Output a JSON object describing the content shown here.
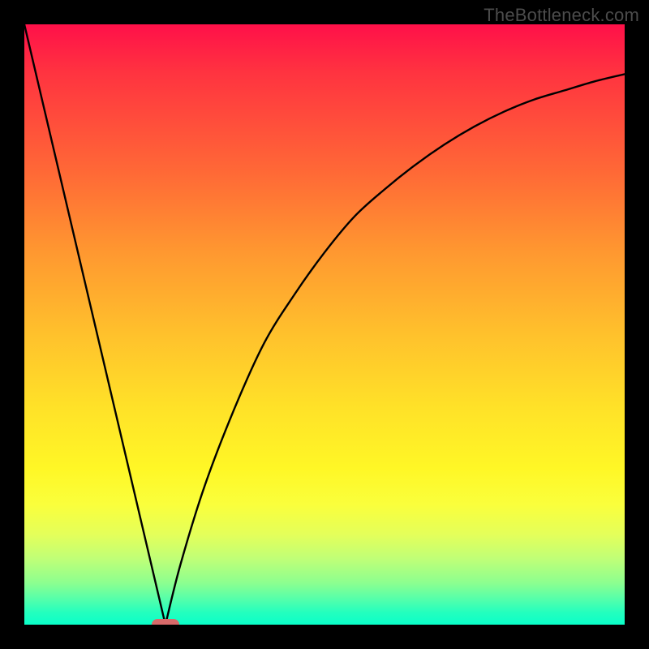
{
  "watermark": "TheBottleneck.com",
  "colors": {
    "frame_bg": "#000000",
    "marker": "#d86a6a",
    "curve": "#000000"
  },
  "chart_data": {
    "type": "line",
    "title": "",
    "xlabel": "",
    "ylabel": "",
    "xlim": [
      0,
      100
    ],
    "ylim": [
      0,
      100
    ],
    "grid": false,
    "legend": false,
    "series": [
      {
        "name": "left-segment",
        "x": [
          0,
          23.5
        ],
        "y": [
          100,
          0
        ]
      },
      {
        "name": "right-segment",
        "x": [
          23.5,
          26,
          30,
          35,
          40,
          45,
          50,
          55,
          60,
          65,
          70,
          75,
          80,
          85,
          90,
          95,
          100
        ],
        "y": [
          0,
          10,
          23,
          36,
          47,
          55,
          62,
          68,
          72.5,
          76.5,
          80,
          83,
          85.5,
          87.5,
          89,
          90.5,
          91.7
        ]
      }
    ],
    "marker": {
      "x": 23.5,
      "y": 0,
      "shape": "rounded-rect"
    },
    "notes": "Values estimated from pixels; y=0 is bottom (green), y=100 is top (red). Right segment is a concave-increasing curve asymptoting toward ~92."
  }
}
